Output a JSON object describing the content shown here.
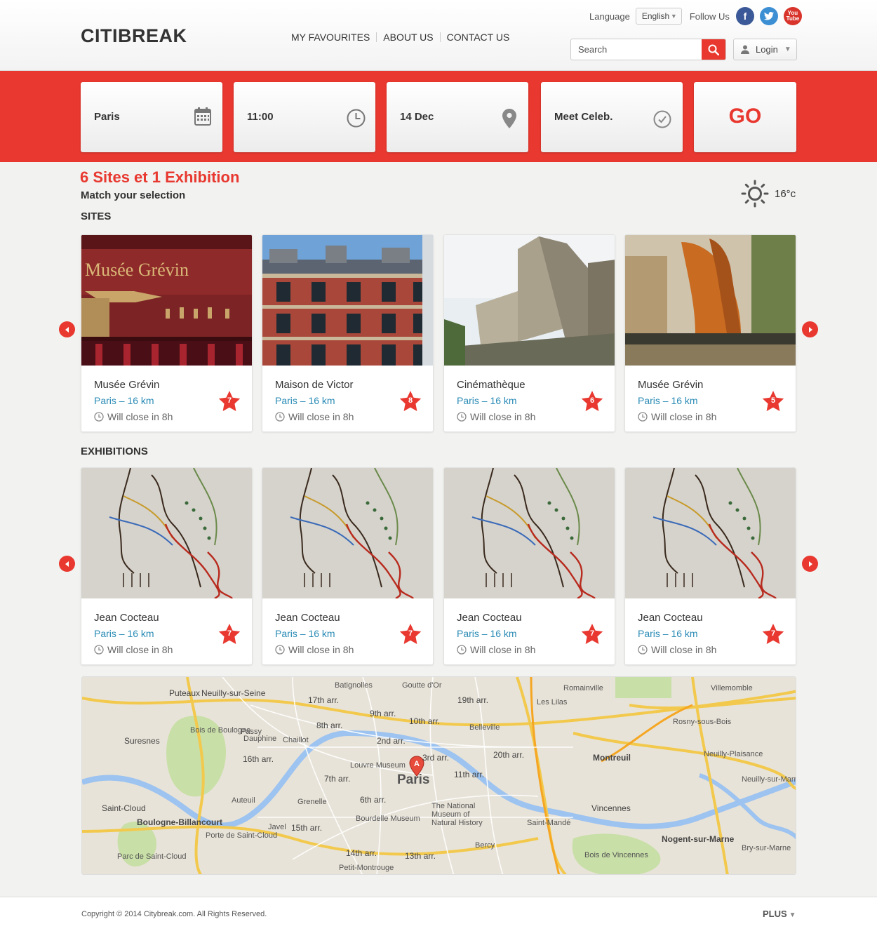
{
  "header": {
    "logo": "CITIBREAK",
    "nav": [
      "MY FAVOURITES",
      "ABOUT US",
      "CONTACT US"
    ],
    "language_label": "Language",
    "language_value": "English",
    "follow_label": "Follow Us",
    "social": [
      "facebook-icon",
      "twitter-icon",
      "youtube-icon"
    ],
    "youtube_text": "You Tube",
    "search_placeholder": "Search",
    "login_label": "Login"
  },
  "filters": {
    "city": "Paris",
    "time": "11:00",
    "date": "14 Dec",
    "activity": "Meet Celeb.",
    "go_label": "GO"
  },
  "results": {
    "title": "6 Sites et 1 Exhibition",
    "subtitle": "Match your selection",
    "temperature": "16°c"
  },
  "sites": {
    "title": "SITES",
    "items": [
      {
        "name": "Musée Grévin",
        "location": "Paris – 16 km",
        "hours": "Will close in 8h",
        "rating": "7"
      },
      {
        "name": "Maison de Victor",
        "location": "Paris – 16 km",
        "hours": "Will close in 8h",
        "rating": "8"
      },
      {
        "name": "Cinémathèque",
        "location": "Paris – 16 km",
        "hours": "Will close in 8h",
        "rating": "6"
      },
      {
        "name": "Musée Grévin",
        "location": "Paris – 16 km",
        "hours": "Will close in 8h",
        "rating": "5"
      }
    ]
  },
  "exhibitions": {
    "title": "EXHIBITIONS",
    "items": [
      {
        "name": "Jean Cocteau",
        "location": "Paris – 16 km",
        "hours": "Will close in 8h",
        "rating": "7"
      },
      {
        "name": "Jean Cocteau",
        "location": "Paris – 16 km",
        "hours": "Will close in 8h",
        "rating": "7"
      },
      {
        "name": "Jean Cocteau",
        "location": "Paris – 16 km",
        "hours": "Will close in 8h",
        "rating": "7"
      },
      {
        "name": "Jean Cocteau",
        "location": "Paris – 16 km",
        "hours": "Will close in 8h",
        "rating": "7"
      }
    ]
  },
  "map": {
    "labels": {
      "neuilly": "Neuilly-sur-Seine",
      "puteaux": "Puteaux",
      "batignolles": "Batignolles",
      "goutte": "Goutte d'Or",
      "romainville": "Romainville",
      "villemomble": "Villemomble",
      "a17": "17th arr.",
      "a19": "19th arr.",
      "a9": "9th arr.",
      "a10": "10th arr.",
      "a8": "8th arr.",
      "a2": "2nd arr.",
      "a3": "3rd arr.",
      "a11": "11th arr.",
      "a20": "20th arr.",
      "a16": "16th arr.",
      "a7": "7th arr.",
      "a6": "6th arr.",
      "a15": "15th arr.",
      "a14": "14th arr.",
      "a13": "13th arr.",
      "leslilas": "Les Lilas",
      "rosny": "Rosny-sous-Bois",
      "belleville": "Belleville",
      "suresnes": "Suresnes",
      "boisboulogne": "Bois de Boulogne",
      "passy": "Passy",
      "dauphine": "Dauphine",
      "chaillot": "Chaillot",
      "louvre": "Louvre Museum",
      "paris": "Paris",
      "montreuil": "Montreuil",
      "neuillyplaisance": "Neuilly-Plaisance",
      "neuillymarne": "Neuilly-sur-Marne",
      "saintcloud": "Saint-Cloud",
      "boulogne": "Boulogne-Billancourt",
      "auteuil": "Auteuil",
      "grenelle": "Grenelle",
      "javel": "Javel",
      "bourdelle": "Bourdelle Museum",
      "natural": "The National Museum of Natural History",
      "vincennes": "Vincennes",
      "saintmande": "Saint-Mandé",
      "boisvincennes": "Bois de Vincennes",
      "nogent": "Nogent-sur-Marne",
      "bry": "Bry-sur-Marne",
      "portestcloud": "Porte de Saint-Cloud",
      "parcstcloud": "Parc de Saint-Cloud",
      "petitmontrouge": "Petit-Montrouge",
      "bercy": "Bercy"
    }
  },
  "footer": {
    "copyright": "Copyright © 2014 Citybreak.com. All Rights Reserved.",
    "plus": "PLUS"
  }
}
